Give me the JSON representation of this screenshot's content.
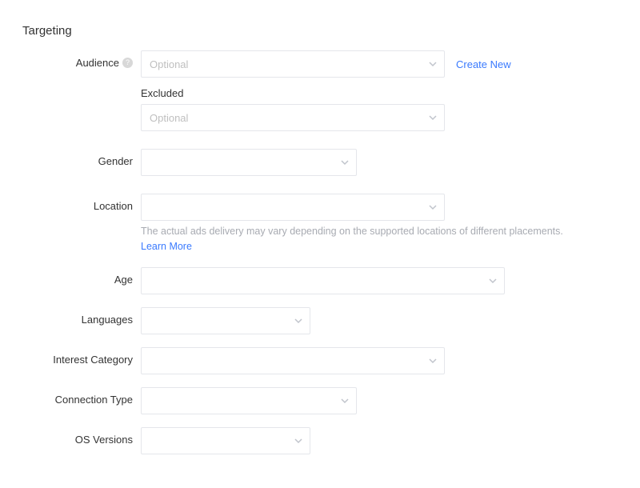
{
  "section": {
    "title": "Targeting"
  },
  "labels": {
    "audience": "Audience",
    "excluded": "Excluded",
    "gender": "Gender",
    "location": "Location",
    "age": "Age",
    "languages": "Languages",
    "interest_category": "Interest Category",
    "connection_type": "Connection Type",
    "os_versions": "OS Versions"
  },
  "placeholders": {
    "audience": "Optional",
    "excluded": "Optional",
    "gender": "",
    "location": "",
    "age": "",
    "languages": "",
    "interest": "",
    "connection": "",
    "os": ""
  },
  "links": {
    "create_new": "Create New",
    "learn_more": "Learn More"
  },
  "helper": {
    "location": "The actual ads delivery may vary depending on the supported locations of different placements."
  }
}
